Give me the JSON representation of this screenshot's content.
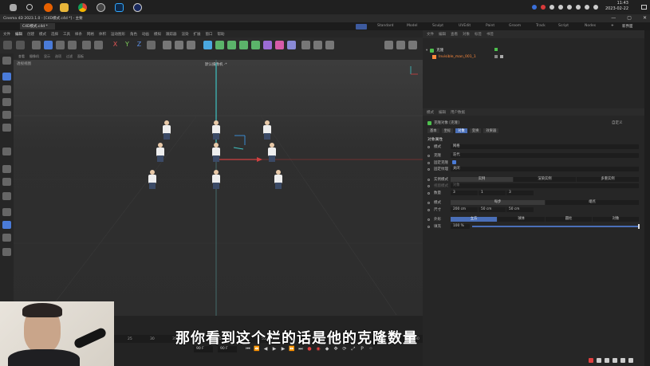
{
  "taskbar": {
    "icons": [
      "windows-icon",
      "search-icon",
      "firefox-icon",
      "file-explorer-icon",
      "chrome-icon",
      "obs-icon",
      "photoshop-icon",
      "cinema4d-icon"
    ],
    "clock_time": "11:43",
    "clock_date": "2023-02-22"
  },
  "window": {
    "title": "Cinema 4D 2023.1.0 - [C4D模式.c4d *] - 主要",
    "min": "—",
    "max": "▢",
    "close": "✕"
  },
  "tabs": {
    "document_tab": "C4D模式.c4d *",
    "layouts": [
      "Standard",
      "Model",
      "Sculpt",
      "UVEdit",
      "Paint",
      "Groom",
      "Track",
      "Script",
      "Nodes"
    ],
    "new_layout": "新界面"
  },
  "menubar": [
    "文件",
    "编辑",
    "创建",
    "模式",
    "选择",
    "工具",
    "样条",
    "网格",
    "体积",
    "运动图形",
    "角色",
    "动画",
    "模拟",
    "跟踪器",
    "渲染",
    "扩展",
    "窗口",
    "帮助"
  ],
  "viewport": {
    "menu": [
      "查看",
      "摄像机",
      "显示",
      "选项",
      "过滤",
      "面板"
    ],
    "label": "透视视图",
    "camera": "默认摄像机 ·*"
  },
  "timeline": {
    "frame_numbers": [
      "25",
      "30",
      "35",
      "40",
      "45",
      "50",
      "55",
      "60",
      "65",
      "70",
      "75",
      "80",
      "85",
      "90"
    ],
    "start_field": "90 F",
    "end_field": "90 F"
  },
  "subtitle": "那你看到这个栏的话是他的克隆数量",
  "object_manager": {
    "tabs": [
      "文件",
      "编辑",
      "查看",
      "对象",
      "标签",
      "书签"
    ],
    "objects": [
      {
        "name": "克隆",
        "color": "#4ec04e"
      },
      {
        "name": "Invisible_man_001_1",
        "color": "#ff8a3d"
      }
    ]
  },
  "attributes": {
    "tabs": [
      "模式",
      "编辑",
      "用户数据"
    ],
    "object_title": "克隆对象 [克隆]",
    "preset": "自定义",
    "subtabs": [
      "基本",
      "坐标",
      "对象",
      "变换",
      "效果器"
    ],
    "active_subtab": "对象",
    "section": "对象属性",
    "rows": {
      "mode_label": "模式",
      "mode_value": "网格",
      "clone_label": "克隆",
      "clone_value": "迭代",
      "fix_clone_label": "固定克隆",
      "fix_texture_label": "固定纹理",
      "fix_texture_value": "关闭",
      "instance_label": "实例模式",
      "instance_options": [
        "实例",
        "渲染实例",
        "多重实例"
      ],
      "viewport_label": "视窗模式",
      "viewport_value": "对象",
      "count_label": "数量",
      "count_values": [
        "3",
        "1",
        "3"
      ],
      "pattern_label": "模式",
      "pattern_options": [
        "每步",
        "端点"
      ],
      "size_label": "尺寸",
      "size_values": [
        "200 cm",
        "50 cm",
        "50 cm"
      ],
      "shape_label": "外形",
      "shape_options": [
        "立方",
        "球体",
        "圆柱",
        "对象"
      ],
      "fill_label": "填充",
      "fill_value": "100 %"
    }
  }
}
